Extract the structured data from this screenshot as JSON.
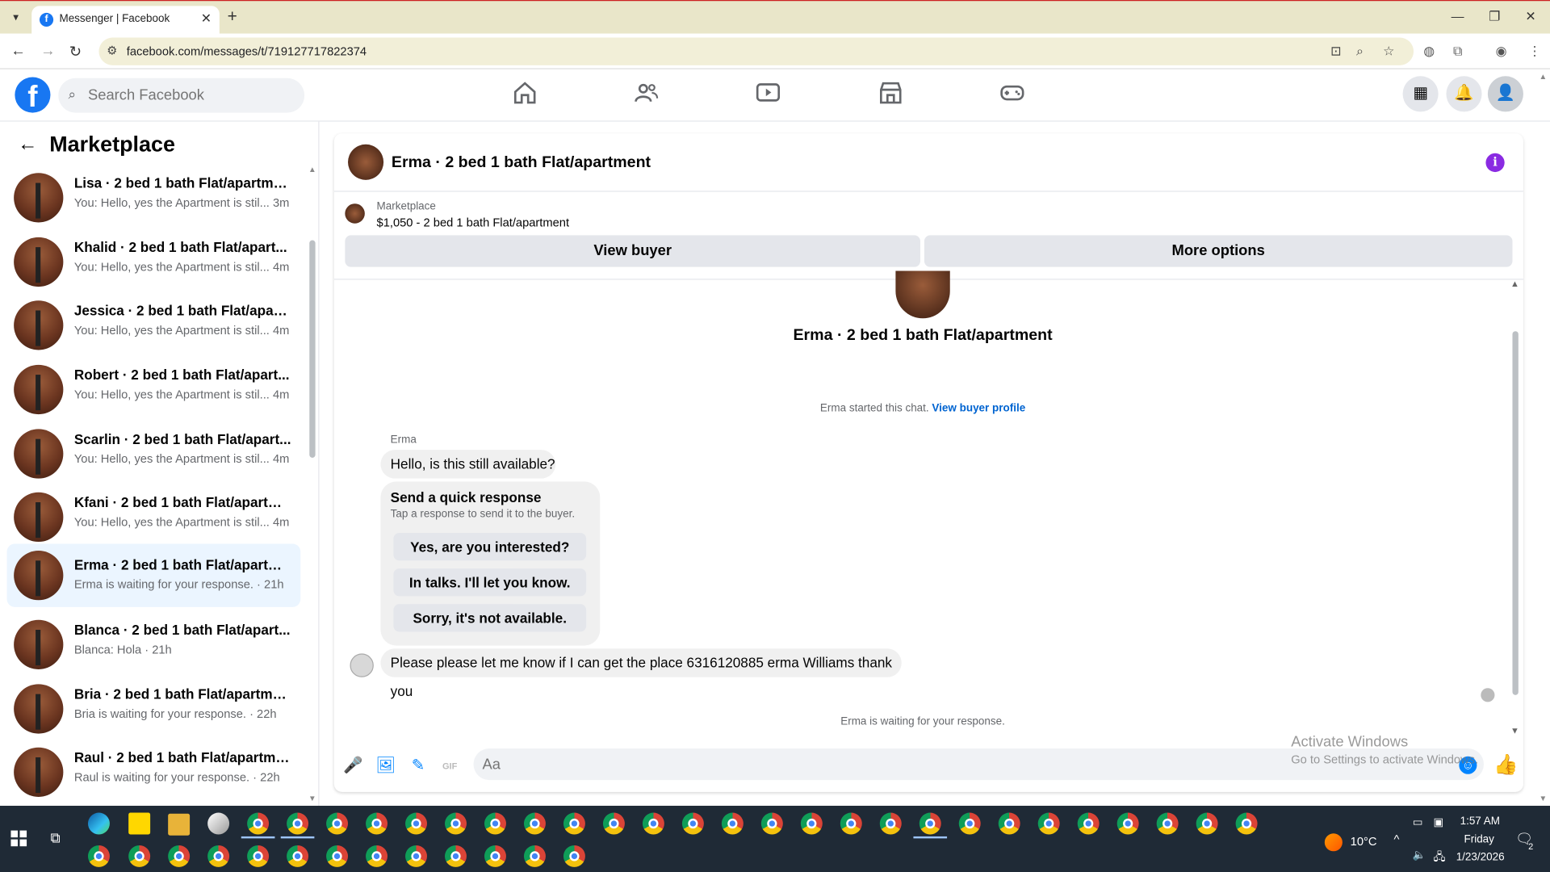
{
  "browser": {
    "tab_title": "Messenger | Facebook",
    "url": "facebook.com/messages/t/719127717822374"
  },
  "fb": {
    "search_placeholder": "Search Facebook"
  },
  "sidebar": {
    "title": "Marketplace",
    "conversations": [
      {
        "name": "Lisa · 2 bed 1 bath Flat/apartment",
        "preview": "You: Hello, yes the Apartment is stil... 3m",
        "active": false
      },
      {
        "name": "Khalid · 2 bed 1 bath Flat/apart...",
        "preview": "You: Hello, yes the Apartment is stil... 4m",
        "active": false
      },
      {
        "name": "Jessica · 2 bed 1 bath Flat/apart...",
        "preview": "You: Hello, yes the Apartment is stil... 4m",
        "active": false
      },
      {
        "name": "Robert · 2 bed 1 bath Flat/apart...",
        "preview": "You: Hello, yes the Apartment is stil... 4m",
        "active": false
      },
      {
        "name": "Scarlin · 2 bed 1 bath Flat/apart...",
        "preview": "You: Hello, yes the Apartment is stil... 4m",
        "active": false
      },
      {
        "name": "Kfani · 2 bed 1 bath Flat/apartm...",
        "preview": "You: Hello, yes the Apartment is stil... 4m",
        "active": false
      },
      {
        "name": "Erma · 2 bed 1 bath Flat/apartme...",
        "preview": "Erma is waiting for your response. · 21h",
        "active": true
      },
      {
        "name": "Blanca · 2 bed 1 bath Flat/apart...",
        "preview": "Blanca: Hola · 21h",
        "active": false
      },
      {
        "name": "Bria · 2 bed 1 bath Flat/apartment",
        "preview": "Bria is waiting for your response. · 22h",
        "active": false
      },
      {
        "name": "Raul · 2 bed 1 bath Flat/apartment",
        "preview": "Raul is waiting for your response. · 22h",
        "active": false
      }
    ]
  },
  "chat": {
    "title": "Erma · 2 bed 1 bath Flat/apartment",
    "listing_label": "Marketplace",
    "listing_price": "$1,050 - 2 bed 1 bath Flat/apartment",
    "view_buyer": "View buyer",
    "more_options": "More options",
    "center_name": "Erma · 2 bed 1 bath Flat/apartment",
    "started_text": "Erma started this chat.",
    "view_profile": "View buyer profile",
    "sender": "Erma",
    "msg1": "Hello, is this still available?",
    "qr_title": "Send a quick response",
    "qr_sub": "Tap a response to send it to the buyer.",
    "qr_options": [
      "Yes, are you interested?",
      "In talks. I'll let you know.",
      "Sorry, it's not available."
    ],
    "msg2": "Please please let me know if I can get the place 6316120885 erma Williams thank you",
    "waiting": "Erma is waiting for your response.",
    "composer_placeholder": "Aa"
  },
  "watermark": {
    "line1": "Activate Windows",
    "line2": "Go to Settings to activate Windows."
  },
  "taskbar": {
    "temperature": "10°C",
    "time": "1:57 AM",
    "day": "Friday",
    "date": "1/23/2026",
    "notifications": "2"
  },
  "colors": {
    "fb_blue": "#1877f2",
    "messenger_blue": "#0084ff",
    "active_conv": "#ebf5ff",
    "info_purple": "#8a2be2"
  }
}
